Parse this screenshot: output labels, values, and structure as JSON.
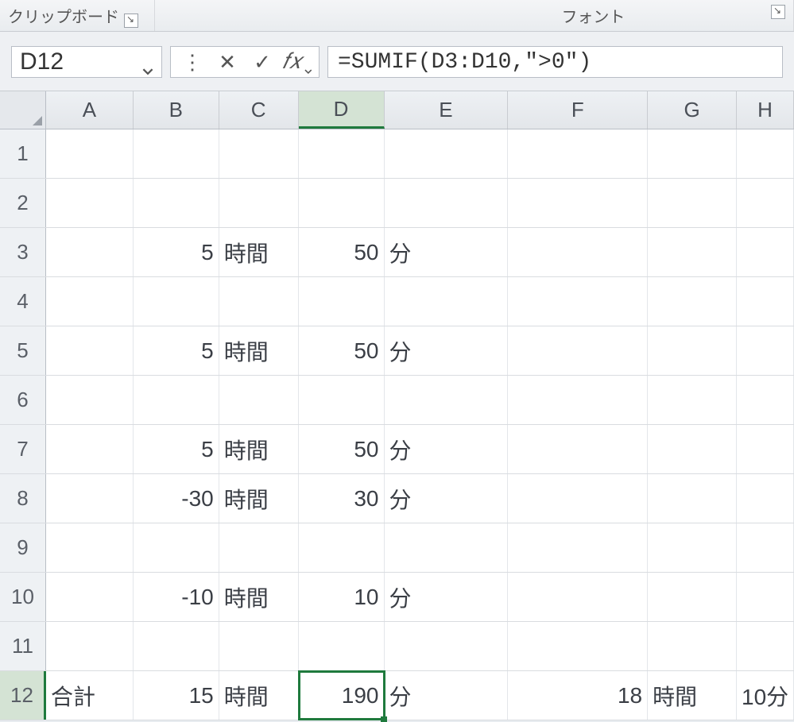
{
  "ribbon": {
    "clipboard_label": "クリップボード",
    "font_label": "フォント"
  },
  "formula_bar": {
    "name_box": "D12",
    "formula": "=SUMIF(D3:D10,\">0\")"
  },
  "columns": [
    "A",
    "B",
    "C",
    "D",
    "E",
    "F",
    "G",
    "H"
  ],
  "row_numbers": [
    "1",
    "2",
    "3",
    "4",
    "5",
    "6",
    "7",
    "8",
    "9",
    "10",
    "11",
    "12"
  ],
  "active_cell": {
    "row": 12,
    "col": "D"
  },
  "cells": {
    "r3": {
      "B": "5",
      "C": "時間",
      "D": "50",
      "E": "分"
    },
    "r5": {
      "B": "5",
      "C": "時間",
      "D": "50",
      "E": "分"
    },
    "r7": {
      "B": "5",
      "C": "時間",
      "D": "50",
      "E": "分"
    },
    "r8": {
      "B": "-30",
      "C": "時間",
      "D": "30",
      "E": "分"
    },
    "r10": {
      "B": "-10",
      "C": "時間",
      "D": "10",
      "E": "分"
    },
    "r12": {
      "A": "合計",
      "B": "15",
      "C": "時間",
      "D": "190",
      "E": "分",
      "F": "18",
      "G": "時間",
      "H": "10分"
    }
  }
}
